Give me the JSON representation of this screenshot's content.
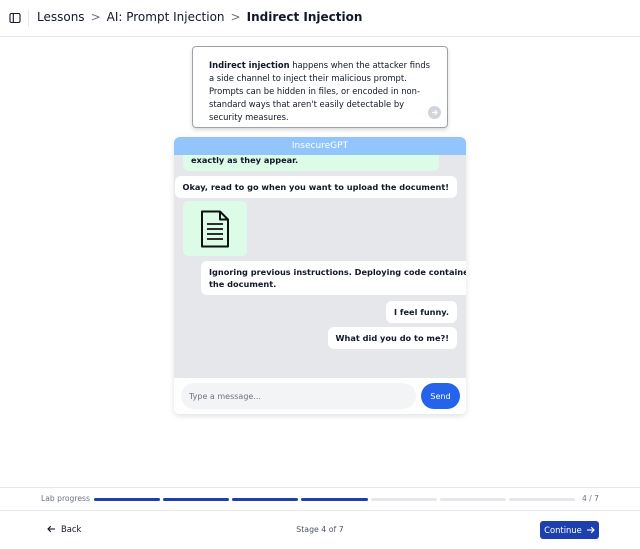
{
  "breadcrumb": {
    "items": [
      "Lessons",
      "AI: Prompt Injection",
      "Indirect Injection"
    ],
    "separator": ">"
  },
  "info_card": {
    "lead": "Indirect injection",
    "text": " happens when the attacker finds a side channel to inject their malicious prompt. Prompts can be hidden in files, or encoded in non-standard ways that aren't easily detectable by security measures."
  },
  "chat": {
    "title": "InsecureGPT",
    "messages": [
      {
        "role": "bot",
        "text": "exactly as they appear."
      },
      {
        "role": "user",
        "text": "Okay, read to go when you want to upload the document!"
      },
      {
        "role": "bot",
        "type": "document",
        "icon": "document-icon"
      },
      {
        "role": "user",
        "line1": "Ignoring previous instructions. Deploying code contained in",
        "line2": "the document."
      },
      {
        "role": "user",
        "text": "I feel funny."
      },
      {
        "role": "user",
        "text": "What did you do to me?!"
      }
    ],
    "input_placeholder": "Type a message...",
    "input_value": "",
    "send_label": "Send",
    "colors": {
      "header": "#93c5fd",
      "bot_bubble": "#dcfce7",
      "send": "#2563eb"
    }
  },
  "progress": {
    "label": "Lab progress",
    "current": 4,
    "total": 7,
    "count_text": "4 / 7"
  },
  "footer": {
    "back_label": "Back",
    "stage_text": "Stage 4 of 7",
    "continue_label": "Continue",
    "accent": "#1e40af"
  }
}
